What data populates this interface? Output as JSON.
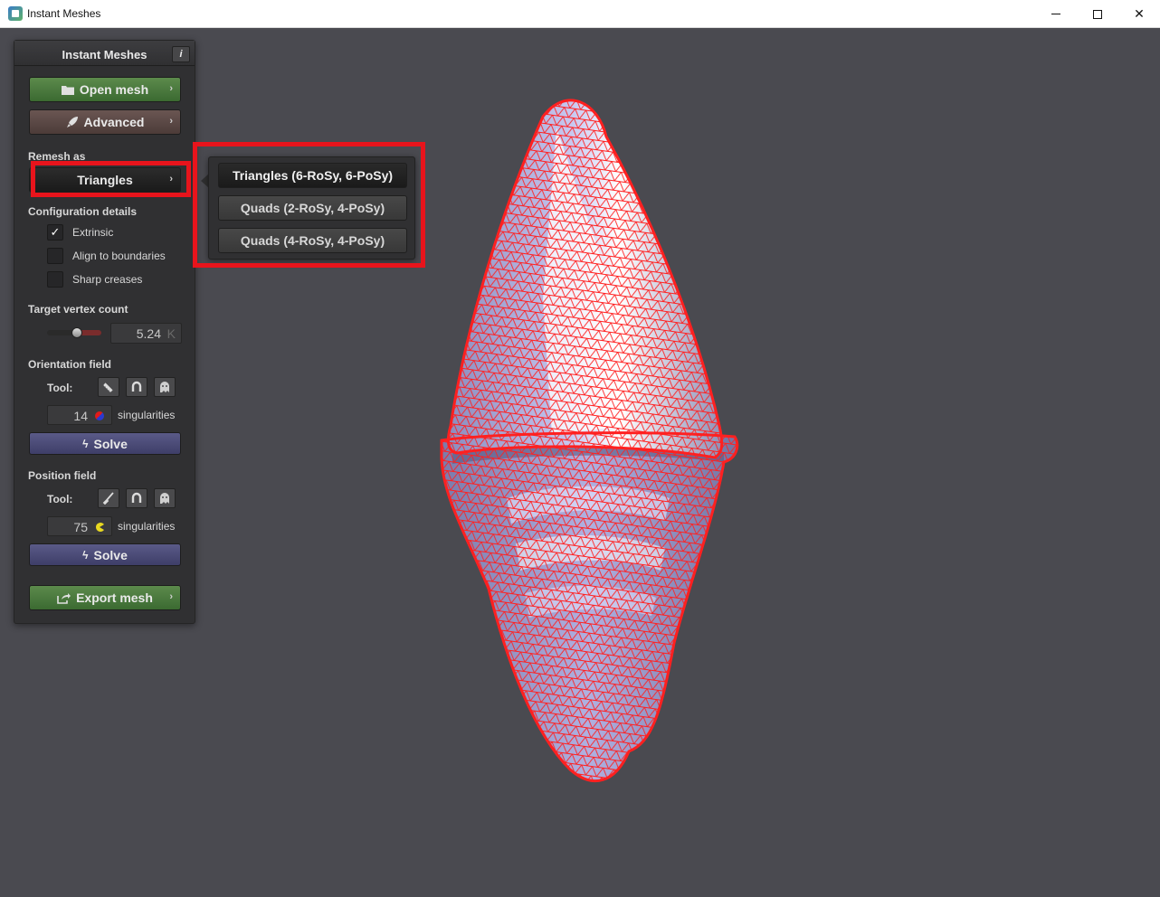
{
  "window": {
    "title": "Instant Meshes"
  },
  "panel": {
    "title": "Instant Meshes",
    "info_label": "i",
    "open_mesh": "Open mesh",
    "advanced": "Advanced",
    "remesh_as_label": "Remesh as",
    "remesh_selected": "Triangles",
    "config_label": "Configuration details",
    "checks": [
      {
        "label": "Extrinsic",
        "checked": true
      },
      {
        "label": "Align to boundaries",
        "checked": false
      },
      {
        "label": "Sharp creases",
        "checked": false
      }
    ],
    "target_label": "Target vertex count",
    "target_value": "5.24",
    "target_unit": "K",
    "orientation_label": "Orientation field",
    "orientation_tool_label": "Tool:",
    "orientation_singularities": "14",
    "singularities_label": "singularities",
    "solve_label": "Solve",
    "position_label": "Position field",
    "position_tool_label": "Tool:",
    "position_singularities": "75",
    "export_mesh": "Export mesh"
  },
  "popup": {
    "items": [
      {
        "label": "Triangles (6-RoSy, 6-PoSy)",
        "selected": true
      },
      {
        "label": "Quads (2-RoSy, 4-PoSy)",
        "selected": false
      },
      {
        "label": "Quads (4-RoSy, 4-PoSy)",
        "selected": false
      }
    ]
  },
  "colors": {
    "viewport_bg": "#4a4a50",
    "wireframe": "#ff2020",
    "mesh_fill": "#b8b8e8",
    "highlight": "#e8141c"
  }
}
